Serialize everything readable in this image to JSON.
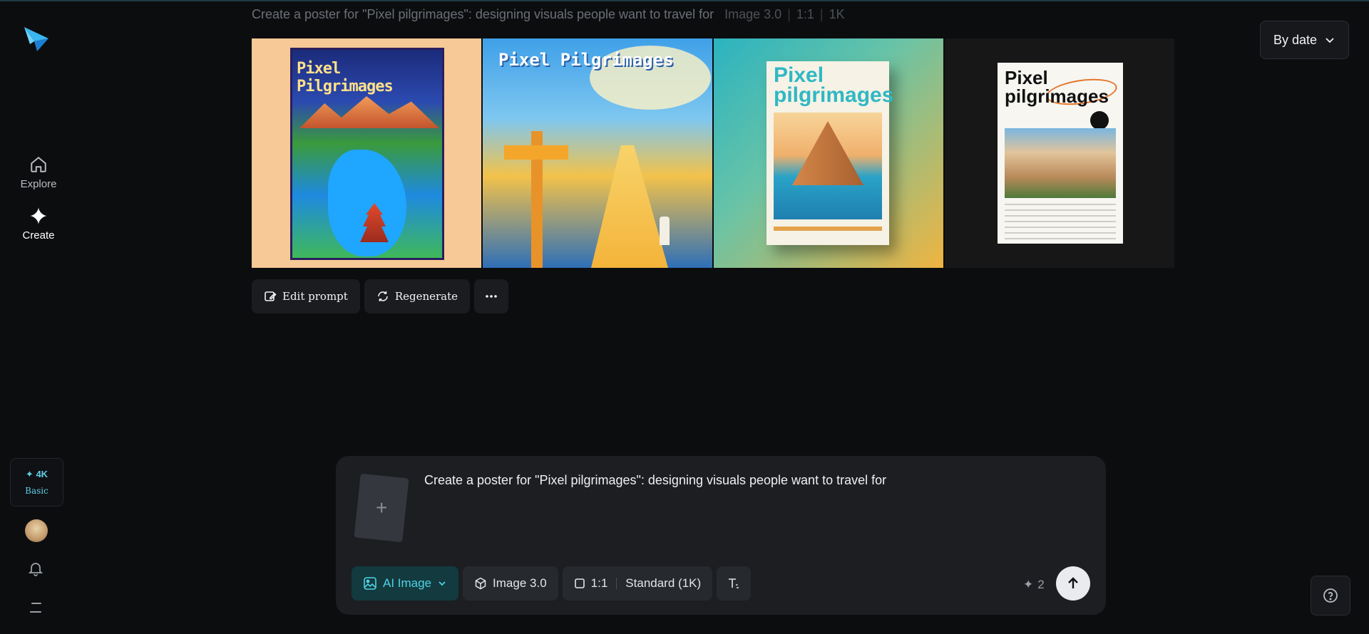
{
  "prompt_header": {
    "text": "Create a poster for \"Pixel pilgrimages\": designing visuals people want to travel for",
    "model": "Image 3.0",
    "ratio": "1:1",
    "resolution": "1K"
  },
  "sort": {
    "label": "By date"
  },
  "sidebar": {
    "explore_label": "Explore",
    "create_label": "Create",
    "credits_amount": "4K",
    "plan": "Basic"
  },
  "gallery": {
    "images": [
      {
        "title": "Pixel Pilgrimages"
      },
      {
        "title": "Pixel Pilgrimages"
      },
      {
        "title": "Pixel pilgrimages"
      },
      {
        "title": "Pixel pilgrimages"
      }
    ]
  },
  "actions": {
    "edit_prompt": "Edit prompt",
    "regenerate": "Regenerate"
  },
  "composer": {
    "prompt": "Create a poster for \"Pixel pilgrimages\": designing visuals people want to travel for",
    "mode": "AI Image",
    "model": "Image 3.0",
    "ratio": "1:1",
    "quality": "Standard (1K)",
    "cost": "2"
  },
  "colors": {
    "accent": "#4fd3e5",
    "background": "#0c0d0f",
    "panel": "#1c1e22"
  }
}
